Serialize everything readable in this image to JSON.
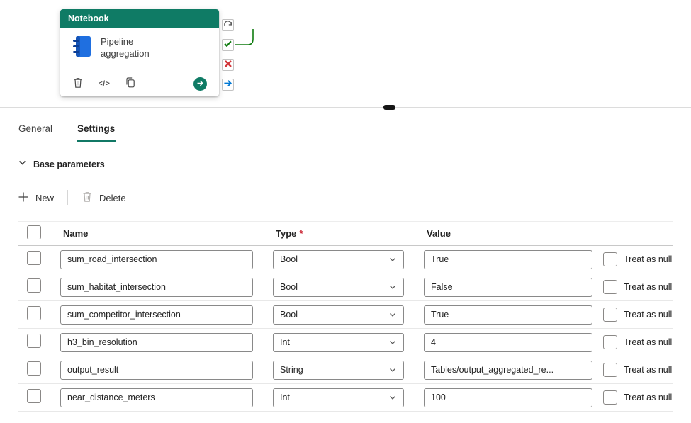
{
  "colors": {
    "accent_teal": "#117865",
    "success_green": "#107c10",
    "error_red": "#d13438",
    "info_blue": "#0078d4",
    "required_red": "#c50f1f"
  },
  "canvas": {
    "card": {
      "type_label": "Notebook",
      "name": "Pipeline aggregation",
      "code_icon_text": "</>"
    },
    "ports": [
      {
        "name": "on-skip"
      },
      {
        "name": "on-success"
      },
      {
        "name": "on-fail"
      },
      {
        "name": "on-completion"
      }
    ]
  },
  "panel": {
    "tabs": [
      {
        "label": "General",
        "active": false
      },
      {
        "label": "Settings",
        "active": true
      }
    ],
    "section_title": "Base parameters",
    "commands": {
      "new": "New",
      "delete": "Delete"
    },
    "table": {
      "headers": {
        "name": "Name",
        "type": "Type",
        "type_required_mark": "*",
        "value": "Value"
      },
      "treat_as_null_label": "Treat as null",
      "rows": [
        {
          "name": "sum_road_intersection",
          "type": "Bool",
          "value": "True"
        },
        {
          "name": "sum_habitat_intersection",
          "type": "Bool",
          "value": "False"
        },
        {
          "name": "sum_competitor_intersection",
          "type": "Bool",
          "value": "True"
        },
        {
          "name": "h3_bin_resolution",
          "type": "Int",
          "value": "4"
        },
        {
          "name": "output_result",
          "type": "String",
          "value": "Tables/output_aggregated_re..."
        },
        {
          "name": "near_distance_meters",
          "type": "Int",
          "value": "100"
        }
      ]
    }
  }
}
